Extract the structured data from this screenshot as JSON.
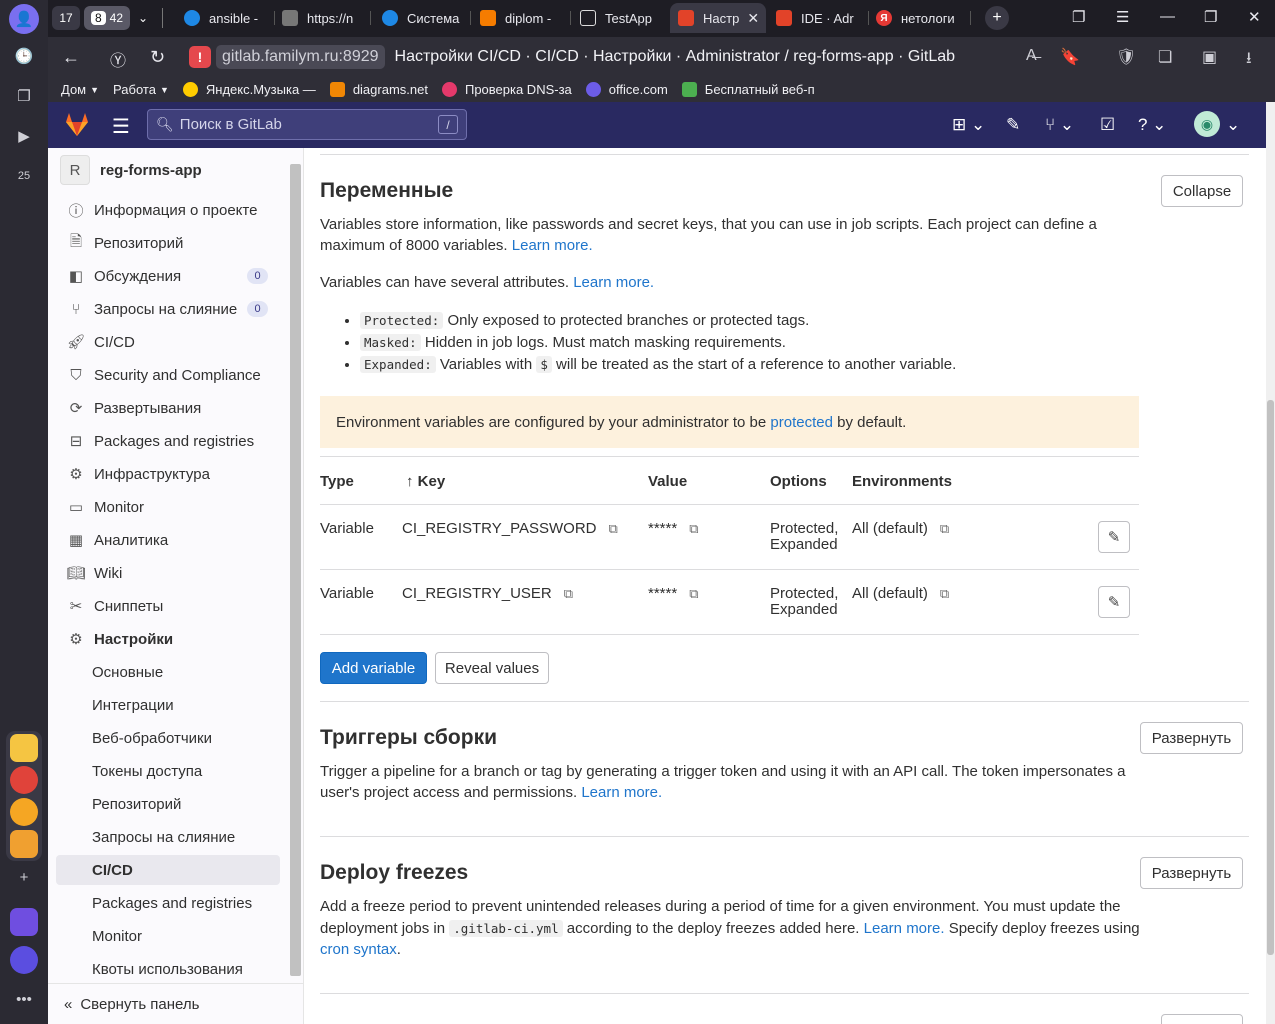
{
  "browser": {
    "tab_counter_a": "17",
    "tab_counter_b": "8",
    "tab_counter_c": "42",
    "tabs": [
      {
        "label": "ansible -",
        "color": "#1e88e5"
      },
      {
        "label": "https://n",
        "color": "#777777"
      },
      {
        "label": "Система",
        "color": "#1e88e5"
      },
      {
        "label": "diplom -",
        "color": "#f57c00"
      },
      {
        "label": "TestApp",
        "color": "#dddddd"
      },
      {
        "label": "Настр",
        "color": "#e24329"
      },
      {
        "label": "IDE · Adr",
        "color": "#e24329"
      },
      {
        "label": "нетологи",
        "color": "#e53935"
      }
    ],
    "url_host": "gitlab.familym.ru:8929",
    "url_title": "Настройки CI/CD · CI/CD · Настройки · Administrator / reg-forms-app · GitLab",
    "bookmarks": [
      {
        "label": "Дом",
        "dropdown": true,
        "color": ""
      },
      {
        "label": "Работа",
        "dropdown": true,
        "color": ""
      },
      {
        "label": "Яндекс.Музыка —",
        "dropdown": false,
        "color": "#ffcc00"
      },
      {
        "label": "diagrams.net",
        "dropdown": false,
        "color": "#f08705"
      },
      {
        "label": "Проверка DNS-за",
        "dropdown": false,
        "color": "#e5396b"
      },
      {
        "label": "office.com",
        "dropdown": false,
        "color": "#6c5ce7"
      },
      {
        "label": "Бесплатный веб-п",
        "dropdown": false,
        "color": "#4caf50"
      }
    ]
  },
  "yandex_sidebar": {
    "calendar_day": "25"
  },
  "gitlab_header": {
    "search_placeholder": "Поиск в GitLab",
    "search_shortcut": "/"
  },
  "sidebar": {
    "project_initial": "R",
    "project_name": "reg-forms-app",
    "items": [
      {
        "label": "Информация о проекте",
        "icon": "info-icon",
        "glyph": "ⓘ"
      },
      {
        "label": "Репозиторий",
        "icon": "document-icon",
        "glyph": "🗎"
      },
      {
        "label": "Обсуждения",
        "icon": "issues-icon",
        "glyph": "◧",
        "badge": "0"
      },
      {
        "label": "Запросы на слияние",
        "icon": "merge-request-icon",
        "glyph": "⑂",
        "badge": "0"
      },
      {
        "label": "CI/CD",
        "icon": "rocket-icon",
        "glyph": "🚀"
      },
      {
        "label": "Security and Compliance",
        "icon": "shield-icon",
        "glyph": "⛉"
      },
      {
        "label": "Развертывания",
        "icon": "deployments-icon",
        "glyph": "⟳"
      },
      {
        "label": "Packages and registries",
        "icon": "package-icon",
        "glyph": "⊟"
      },
      {
        "label": "Инфраструктура",
        "icon": "cloud-gear-icon",
        "glyph": "⚙"
      },
      {
        "label": "Monitor",
        "icon": "monitor-icon",
        "glyph": "▭"
      },
      {
        "label": "Аналитика",
        "icon": "chart-icon",
        "glyph": "▦"
      },
      {
        "label": "Wiki",
        "icon": "book-icon",
        "glyph": "📖"
      },
      {
        "label": "Сниппеты",
        "icon": "scissors-icon",
        "glyph": "✂"
      },
      {
        "label": "Настройки",
        "icon": "settings-icon",
        "glyph": "⚙",
        "bold": true
      }
    ],
    "subitems": [
      {
        "label": "Основные"
      },
      {
        "label": "Интеграции"
      },
      {
        "label": "Веб-обработчики"
      },
      {
        "label": "Токены доступа"
      },
      {
        "label": "Репозиторий"
      },
      {
        "label": "Запросы на слияние"
      },
      {
        "label": "CI/CD",
        "active": true
      },
      {
        "label": "Packages and registries"
      },
      {
        "label": "Monitor"
      },
      {
        "label": "Квоты использования"
      }
    ],
    "collapse_label": "Свернуть панель"
  },
  "variables_section": {
    "title": "Переменные",
    "collapse_button": "Collapse",
    "intro": "Variables store information, like passwords and secret keys, that you can use in job scripts. Each project can define a maximum of 8000 variables.",
    "learn_more_1": "Learn more.",
    "attributes_text": "Variables can have several attributes.",
    "learn_more_2": "Learn more.",
    "attributes": [
      {
        "code": "Protected:",
        "text": "Only exposed to protected branches or protected tags."
      },
      {
        "code": "Masked:",
        "text": "Hidden in job logs. Must match masking requirements."
      },
      {
        "code": "Expanded:",
        "text_before": "Variables with",
        "inline_code": "$",
        "text_after": "will be treated as the start of a reference to another variable."
      }
    ],
    "alert_before": "Environment variables are configured by your administrator to be",
    "alert_link": "protected",
    "alert_after": "by default.",
    "table": {
      "headers": {
        "type": "Type",
        "key": "Key",
        "value": "Value",
        "options": "Options",
        "environments": "Environments"
      },
      "rows": [
        {
          "type": "Variable",
          "key": "CI_REGISTRY_PASSWORD",
          "value": "*****",
          "options_1": "Protected,",
          "options_2": "Expanded",
          "environment": "All (default)"
        },
        {
          "type": "Variable",
          "key": "CI_REGISTRY_USER",
          "value": "*****",
          "options_1": "Protected,",
          "options_2": "Expanded",
          "environment": "All (default)"
        }
      ]
    },
    "add_button": "Add variable",
    "reveal_button": "Reveal values"
  },
  "triggers_section": {
    "title": "Триггеры сборки",
    "expand_button": "Развернуть",
    "text": "Trigger a pipeline for a branch or tag by generating a trigger token and using it with an API call. The token impersonates a user's project access and permissions.",
    "learn_more": "Learn more."
  },
  "freezes_section": {
    "title": "Deploy freezes",
    "expand_button": "Развернуть",
    "text_before": "Add a freeze period to prevent unintended releases during a period of time for a given environment. You must update the deployment jobs in",
    "code": ".gitlab-ci.yml",
    "text_middle": "according to the deploy freezes added here.",
    "learn_more": "Learn more.",
    "text_after": "Specify deploy freezes using",
    "cron_link": "cron syntax",
    "period": "."
  }
}
